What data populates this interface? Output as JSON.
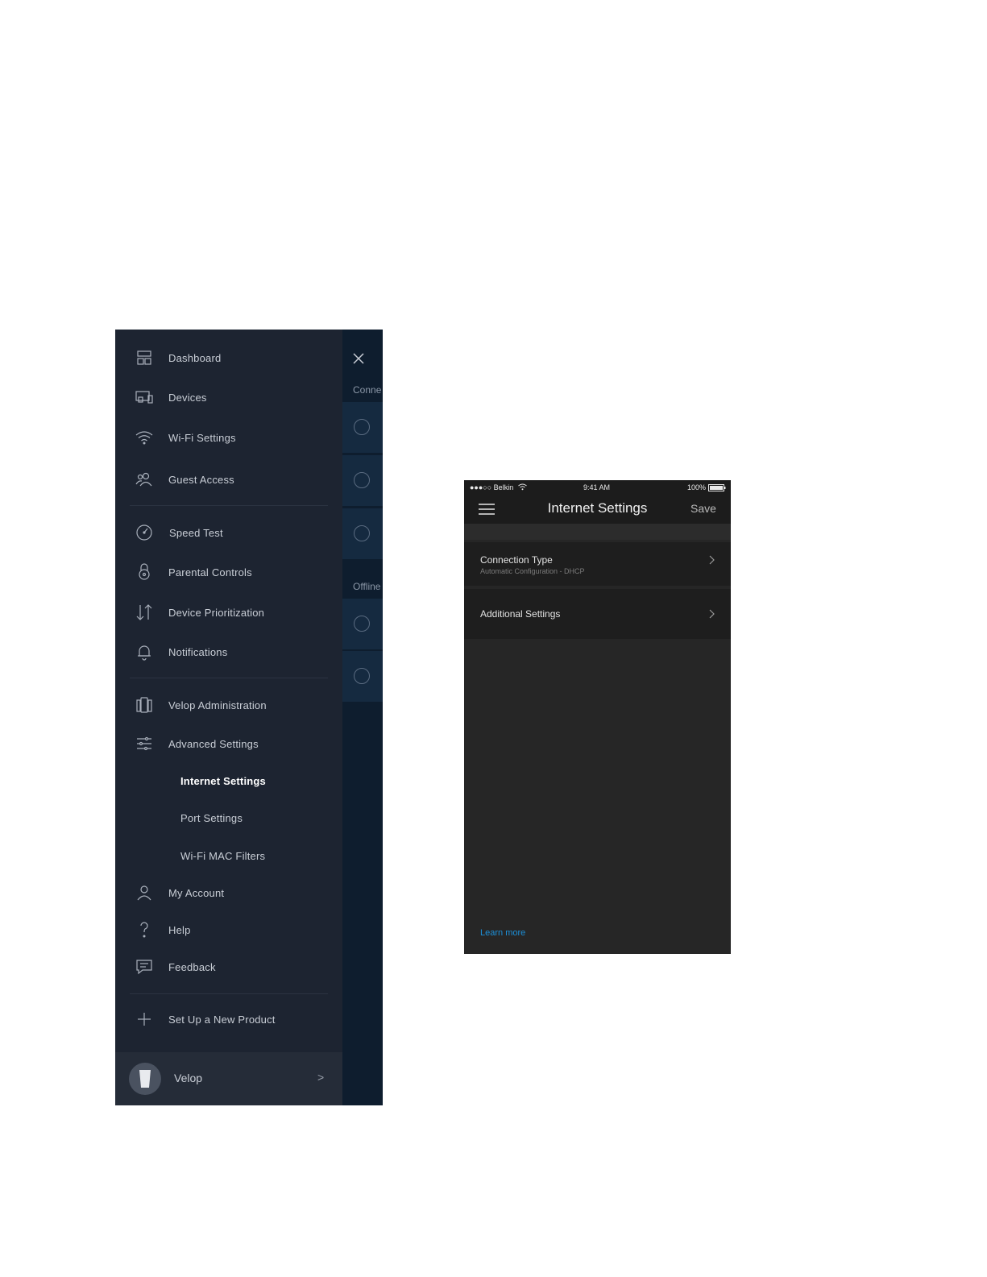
{
  "menu_phone": {
    "items": [
      {
        "label": "Dashboard",
        "icon": "dashboard-icon"
      },
      {
        "label": "Devices",
        "icon": "devices-icon"
      },
      {
        "label": "Wi-Fi Settings",
        "icon": "wifi-icon"
      },
      {
        "label": "Guest Access",
        "icon": "guest-access-icon"
      },
      {
        "label": "Speed Test",
        "icon": "speedometer-icon"
      },
      {
        "label": "Parental Controls",
        "icon": "lock-icon"
      },
      {
        "label": "Device Prioritization",
        "icon": "up-down-arrows-icon"
      },
      {
        "label": "Notifications",
        "icon": "bell-icon"
      },
      {
        "label": "Velop Administration",
        "icon": "velop-admin-icon"
      },
      {
        "label": "Advanced Settings",
        "icon": "sliders-icon"
      }
    ],
    "advanced_sub_items": [
      {
        "label": "Internet Settings",
        "active": true
      },
      {
        "label": "Port Settings",
        "active": false
      },
      {
        "label": "Wi-Fi MAC Filters",
        "active": false
      }
    ],
    "bottom_items": [
      {
        "label": "My Account",
        "icon": "user-icon"
      },
      {
        "label": "Help",
        "icon": "question-icon"
      },
      {
        "label": "Feedback",
        "icon": "chat-icon"
      }
    ],
    "setup_label": "Set Up a New Product",
    "account": {
      "label": "Velop",
      "chevron": ">"
    },
    "background": {
      "connected_label": "Conne",
      "offline_label": "Offline"
    }
  },
  "settings_phone": {
    "status": {
      "carrier": "●●●○○ Belkin",
      "time": "9:41 AM",
      "battery": "100%"
    },
    "title": "Internet Settings",
    "save_label": "Save",
    "rows": [
      {
        "title": "Connection Type",
        "subtitle": "Automatic Configuration - DHCP"
      },
      {
        "title": "Additional Settings",
        "subtitle": ""
      }
    ],
    "learn_more": "Learn more"
  },
  "colors": {
    "drawer_bg": "#1d2431",
    "settings_bg": "#262626",
    "link": "#1c8fd8"
  }
}
